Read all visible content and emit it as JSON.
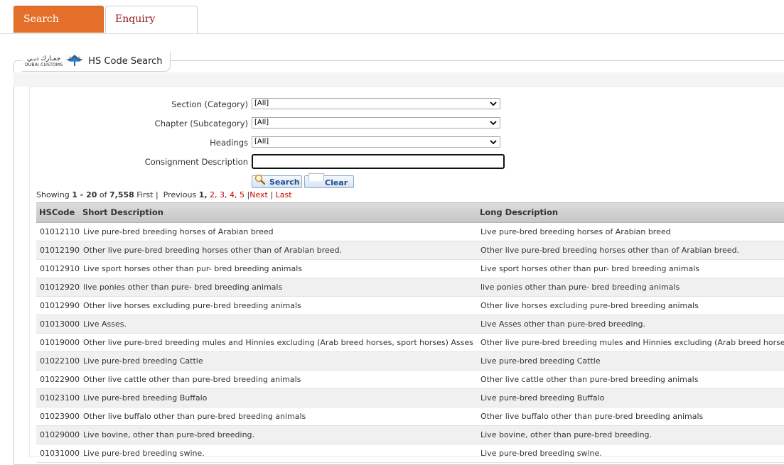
{
  "tabs": [
    {
      "label": "Search"
    },
    {
      "label": "Enquiry"
    }
  ],
  "panel": {
    "logo_arabic": "جمـارك دبـي",
    "logo_english": "DUBAI CUSTOMS",
    "title": "HS Code Search"
  },
  "form": {
    "section_label": "Section (Category)",
    "section_value": "[All]",
    "chapter_label": "Chapter (Subcategory)",
    "chapter_value": "[All]",
    "headings_label": "Headings",
    "headings_value": "[All]",
    "consignment_label": "Consignment Description",
    "consignment_value": "",
    "search_button": "Search",
    "clear_button": "Clear"
  },
  "pager": {
    "showing": "Showing",
    "range": "1 - 20",
    "of": "of",
    "total": "7,558",
    "first": "First",
    "sep1": "|",
    "previous": "Previous",
    "current": "1,",
    "pages": [
      "2,",
      "3,",
      "4,",
      "5"
    ],
    "sep2": "|",
    "next": "Next",
    "sep3": "|",
    "last": "Last"
  },
  "table": {
    "headers": {
      "code": "HSCode",
      "short": "Short Description",
      "long": "Long Description"
    },
    "rows": [
      {
        "code": "01012110",
        "short": "Live pure-bred breeding horses of Arabian breed",
        "long": "Live pure-bred breeding horses of Arabian breed"
      },
      {
        "code": "01012190",
        "short": "Other live pure-bred breeding horses other than of Arabian breed.",
        "long": "Other live pure-bred breeding horses other than of Arabian breed."
      },
      {
        "code": "01012910",
        "short": "Live sport horses other than pur- bred breeding animals",
        "long": "Live sport horses other than pur- bred breeding animals"
      },
      {
        "code": "01012920",
        "short": "live ponies other than pure- bred breeding animals",
        "long": "live ponies other than pure- bred breeding animals"
      },
      {
        "code": "01012990",
        "short": "Other live horses excluding pure-bred breeding animals",
        "long": "Other live horses excluding pure-bred breeding animals"
      },
      {
        "code": "01013000",
        "short": "Live Asses.",
        "long": "Live Asses other than pure-bred breeding."
      },
      {
        "code": "01019000",
        "short": "Other live pure-bred breeding mules and Hinnies excluding (Arab breed horses, sport horses) Asses,po",
        "long": "Other live pure-bred breeding mules and Hinnies excluding (Arab breed horses,"
      },
      {
        "code": "01022100",
        "short": "Live pure-bred breeding Cattle",
        "long": "Live pure-bred breeding Cattle"
      },
      {
        "code": "01022900",
        "short": "Other live cattle other than pure-bred breeding animals",
        "long": "Other live cattle other than pure-bred breeding animals"
      },
      {
        "code": "01023100",
        "short": "Live pure-bred breeding Buffalo",
        "long": "Live pure-bred breeding Buffalo"
      },
      {
        "code": "01023900",
        "short": "Other live buffalo other than pure-bred breeding animals",
        "long": "Other live buffalo other than pure-bred breeding animals"
      },
      {
        "code": "01029000",
        "short": "Live bovine, other than pure-bred breeding.",
        "long": "Live bovine, other than pure-bred breeding."
      },
      {
        "code": "01031000",
        "short": "Live pure-bred breeding swine.",
        "long": "Live pure-bred breeding swine."
      }
    ]
  }
}
